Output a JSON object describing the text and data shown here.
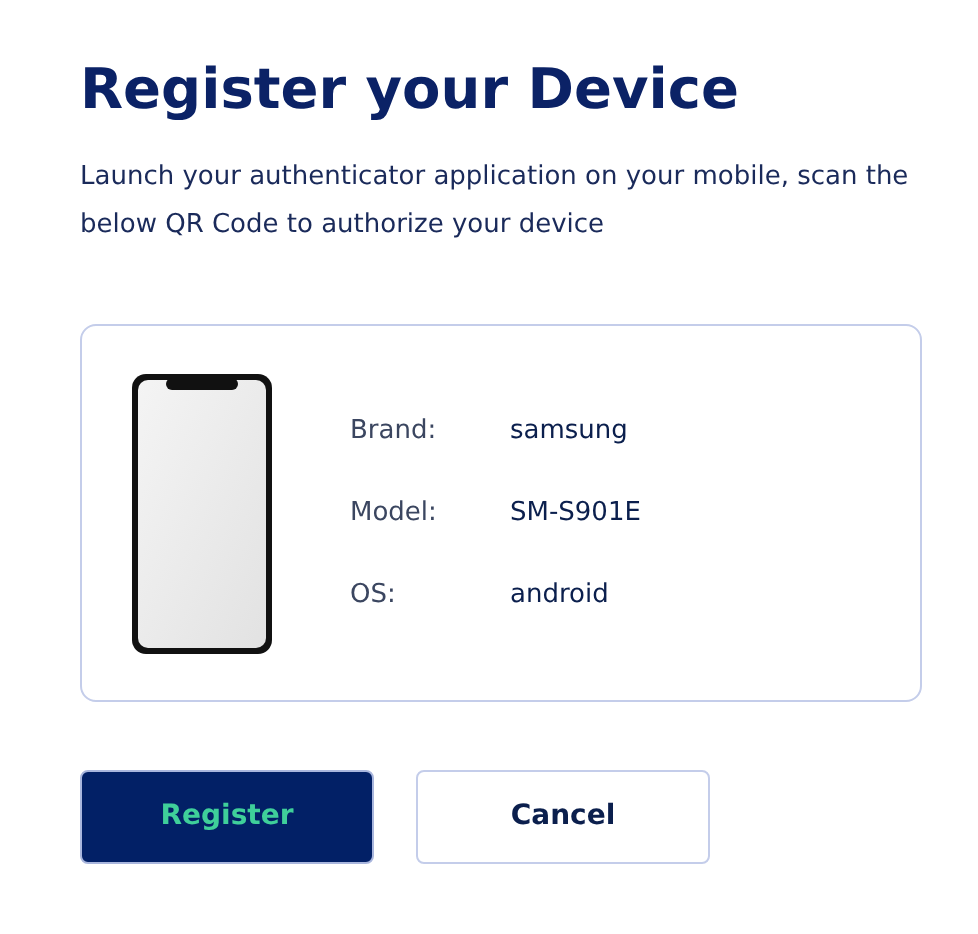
{
  "title": "Register your Device",
  "description": "Launch your authenticator application on your mobile, scan the below QR Code to authorize your device",
  "device": {
    "fields": [
      {
        "label": "Brand:",
        "value": "samsung"
      },
      {
        "label": "Model:",
        "value": "SM-S901E"
      },
      {
        "label": "OS:",
        "value": "android"
      }
    ]
  },
  "buttons": [
    {
      "label": "Register",
      "kind": "primary"
    },
    {
      "label": "Cancel",
      "kind": "secondary"
    }
  ]
}
